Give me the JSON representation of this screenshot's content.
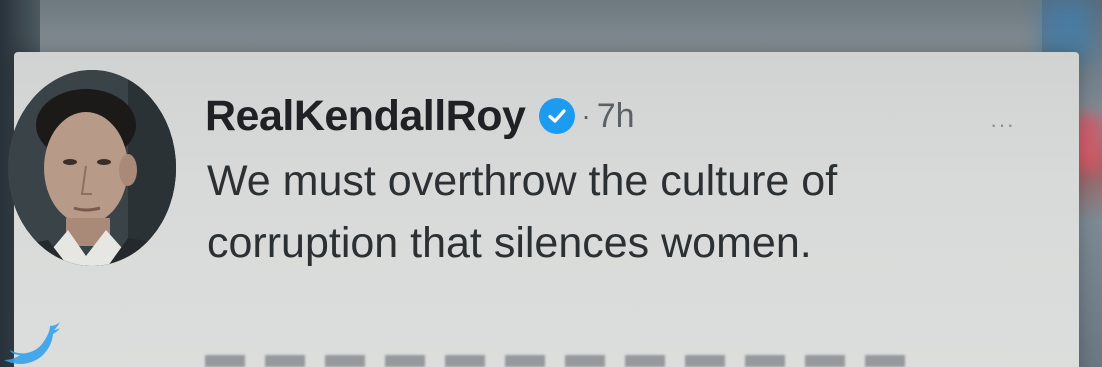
{
  "tweet": {
    "display_name": "RealKendallRoy",
    "separator": "·",
    "timestamp": "7h",
    "text": "We must overthrow the culture of\ncorruption that silences women.",
    "more_label": "···"
  },
  "icons": {
    "verified": "verified-badge-icon",
    "more": "more-options-icon",
    "bird": "twitter-bird-icon"
  },
  "colors": {
    "verified_blue": "#1d9bf0",
    "name_text": "#1e2224",
    "body_text": "#2b3033",
    "meta_text": "#5a6064"
  }
}
